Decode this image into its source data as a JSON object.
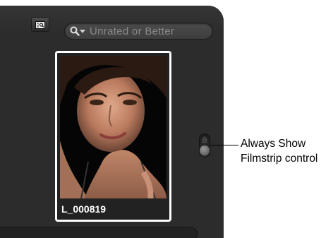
{
  "toolbar": {
    "view_button_icon": "browser-view-icon",
    "search_icon": "magnifier-icon",
    "search_placeholder": "Unrated or Better"
  },
  "thumbnail": {
    "filename": "L_000819",
    "selected": true,
    "border_color": "#ffffff"
  },
  "filmstrip_toggle": {
    "icon": "lock-icon",
    "state": "off"
  },
  "callout": {
    "line1": "Always Show",
    "line2": "Filmstrip control"
  },
  "colors": {
    "panel_bg": "#2c2c2c",
    "page_bg": "#ffffff"
  }
}
